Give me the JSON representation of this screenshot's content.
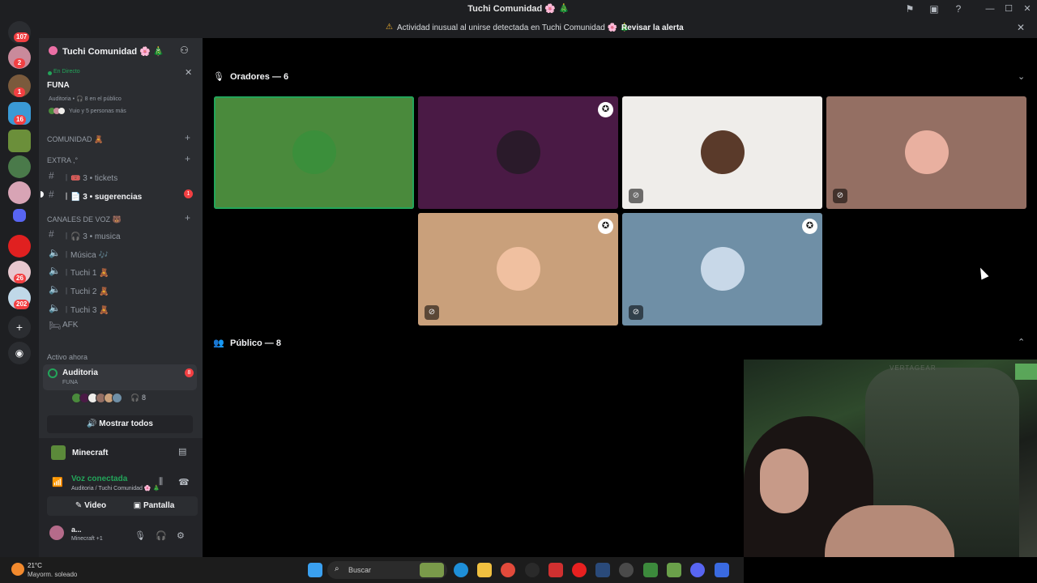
{
  "window": {
    "title": "Tuchi Comunidad 🌸 🎄",
    "controls": [
      "minimize",
      "maximize",
      "close"
    ]
  },
  "banner": {
    "text": "Actividad inusual al unirse detectada en Tuchi Comunidad 🌸 🎄",
    "action": "Revisar la alerta"
  },
  "servers": {
    "home_badge": "107",
    "badges": [
      "2",
      "1",
      "16",
      "26",
      "202"
    ]
  },
  "guild": {
    "name": "Tuchi Comunidad 🌸 🎄"
  },
  "stage_live": {
    "status": "En Directo",
    "title": "FUNA",
    "meta": "Auditoria • 🎧 8 en el público",
    "meta2": "Yuio y 5 personas más"
  },
  "categories": {
    "comunidad": "COMUNIDAD 🧸",
    "extra": "EXTRA ,°",
    "voice": "CANALES DE VOZ 🐻"
  },
  "channels": {
    "tickets": "︱🎟️ 3 • tickets",
    "sugerencias": "︱📄 3 • sugerencias",
    "sugerencias_badge": "1",
    "musica_text": "︱🎧 3 • musica",
    "musica": "︱Música 🎶",
    "tuchi1": "︱Tuchi 1 🧸",
    "tuchi2": "︱Tuchi 2 🧸",
    "tuchi3": "︱Tuchi 3 🧸",
    "afk": "AFK"
  },
  "active_now": {
    "label": "Activo ahora",
    "name": "Auditoria",
    "sub": "FUNA",
    "badge": "8",
    "listeners": "🎧 8",
    "show_all": "Mostrar todos"
  },
  "activity": {
    "game": "Minecraft"
  },
  "voice": {
    "status": "Voz conectada",
    "channel": "Auditoria / Tuchi Comunidad 🌸 🎄",
    "video": "Video",
    "screen": "Pantalla"
  },
  "user": {
    "name": "a...",
    "status": "Minecraft +1"
  },
  "stage": {
    "speakers_heading": "Oradores — 6",
    "audience_heading": "Público — 8",
    "speakers": [
      {
        "bg": "#4a8a3c",
        "speaking": true,
        "muted": false,
        "moderator": false
      },
      {
        "bg": "#4a1a45",
        "speaking": false,
        "muted": false,
        "moderator": true
      },
      {
        "bg": "#efedea",
        "speaking": false,
        "muted": true,
        "moderator": false
      },
      {
        "bg": "#946f63",
        "speaking": false,
        "muted": true,
        "moderator": false
      },
      {
        "bg": "#c9a07b",
        "speaking": false,
        "muted": true,
        "moderator": true
      },
      {
        "bg": "#6f8fa6",
        "speaking": false,
        "muted": true,
        "moderator": true
      }
    ]
  },
  "webcam": {
    "chair_brand": "VERTAGEAR"
  },
  "taskbar": {
    "temp": "21°C",
    "weather": "Mayorm. soleado",
    "search_placeholder": "Buscar"
  },
  "colors": {
    "accent_green": "#23a55a",
    "danger_red": "#f23f42",
    "sidebar_bg": "#2b2d31",
    "server_bg": "#1e1f22"
  }
}
